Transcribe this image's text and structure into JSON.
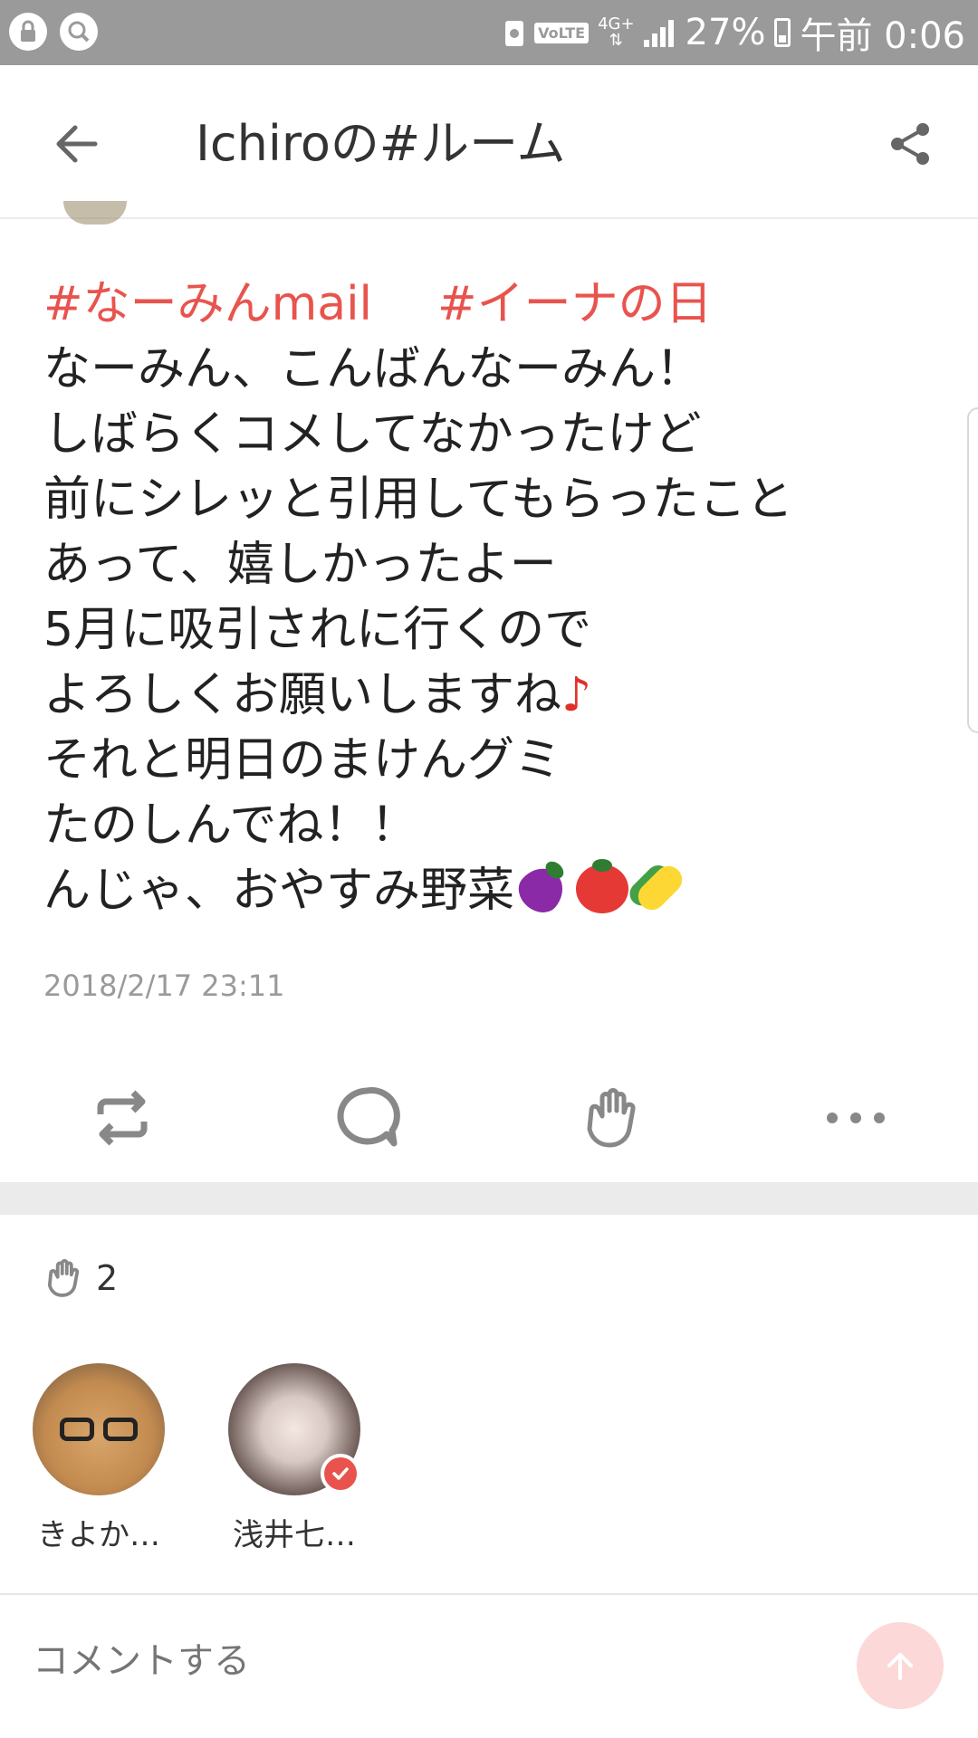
{
  "status_bar": {
    "volte": "VoLTE",
    "network": "4G+",
    "battery": "27%",
    "time": "午前 0:06"
  },
  "header": {
    "title": "Ichiroの#ルーム"
  },
  "post": {
    "tags": [
      "#なーみんmail",
      "#イーナの日"
    ],
    "lines": [
      "なーみん、こんばんなーみん！",
      "しばらくコメしてなかったけど",
      "前にシレッと引用してもらったこと",
      "あって、嬉しかったよー",
      "5月に吸引されに行くので",
      "よろしくお願いしますね",
      "それと明日のまけんグミ",
      "たのしんでね！！",
      "んじゃ、おやすみ野菜"
    ],
    "note_glyph": "♪",
    "timestamp": "2018/2/17 23:11"
  },
  "actions": {
    "icons": [
      "repost-icon",
      "comment-icon",
      "clap-icon",
      "more-icon"
    ]
  },
  "likes": {
    "count": "2",
    "users": [
      {
        "name": "きよか…"
      },
      {
        "name": "浅井七…"
      }
    ]
  },
  "comment": {
    "placeholder": "コメントする"
  },
  "colors": {
    "accent": "#e8544d",
    "send_button": "#fcd9d8",
    "status_bar": "#9a9a9a"
  }
}
